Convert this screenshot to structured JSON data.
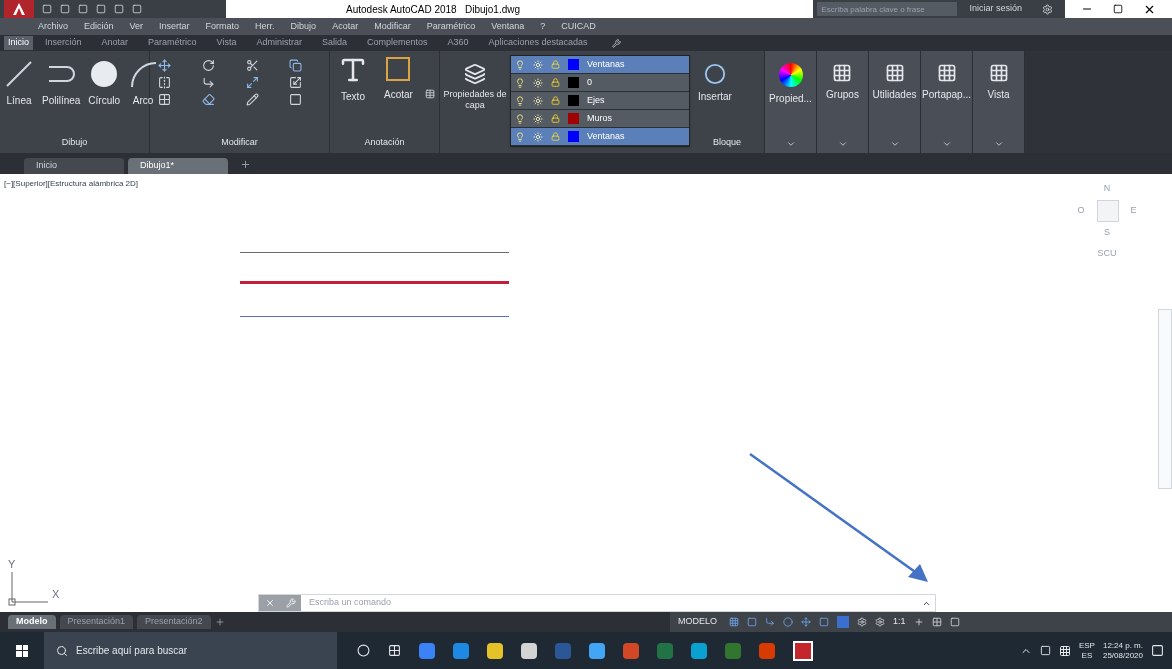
{
  "title_bar": {
    "title": "Autodesk AutoCAD 2018   Dibujo1.dwg",
    "search": {
      "placeholder": "Escriba palabra clave o frase"
    },
    "sign_in": "Iniciar sesión"
  },
  "menu_bar": [
    "Archivo",
    "Edición",
    "Ver",
    "Insertar",
    "Formato",
    "Herr.",
    "Dibujo",
    "Acotar",
    "Modificar",
    "Paramétrico",
    "Ventana",
    "?",
    "CUICAD"
  ],
  "ribbon_tabs": [
    {
      "label": "Inicio",
      "selected": true
    },
    {
      "label": "Inserción",
      "selected": false
    },
    {
      "label": "Anotar",
      "selected": false
    },
    {
      "label": "Paramétrico",
      "selected": false
    },
    {
      "label": "Vista",
      "selected": false
    },
    {
      "label": "Administrar",
      "selected": false
    },
    {
      "label": "Salida",
      "selected": false
    },
    {
      "label": "Complementos",
      "selected": false
    },
    {
      "label": "A360",
      "selected": false
    },
    {
      "label": "Aplicaciones destacadas",
      "selected": false
    }
  ],
  "draw_panel": {
    "title": "Dibujo",
    "tools": [
      "Línea",
      "Polilínea",
      "Círculo",
      "Arco"
    ]
  },
  "modify_panel": {
    "title": "Modificar"
  },
  "annotation_panel": {
    "title": "Anotación",
    "tools": [
      "Texto",
      "Acotar"
    ]
  },
  "layer_properties": "Propiedades de capa",
  "layer_dropdown": {
    "current": {
      "name": "Ventanas",
      "color": "#0000ff"
    },
    "layers": [
      {
        "name": "0",
        "color": "#000000",
        "selected": false
      },
      {
        "name": "Ejes",
        "color": "#000000",
        "selected": false
      },
      {
        "name": "Muros",
        "color": "#a00000",
        "selected": false
      },
      {
        "name": "Ventanas",
        "color": "#0000ff",
        "selected": true
      }
    ]
  },
  "block_panel": {
    "title": "Bloque",
    "tool": "Insertar"
  },
  "extra_panels": [
    "Propied...",
    "Grupos",
    "Utilidades",
    "Portapap...",
    "Vista"
  ],
  "document_tabs": [
    {
      "label": "Inicio",
      "selected": false
    },
    {
      "label": "Dibujo1*",
      "selected": true
    }
  ],
  "viewport_label": "[−][Superior][Estructura alámbrica 2D]",
  "drawing_lines": [
    {
      "color": "#6b6b6b"
    },
    {
      "color": "#c0203a"
    },
    {
      "color": "#5a6cc8"
    }
  ],
  "view_cube": {
    "north": "N",
    "west": "O",
    "east": "E",
    "south": "S",
    "ucs": "SCU"
  },
  "ucs_icon": {
    "y": "Y",
    "x": "X"
  },
  "command_line": {
    "placeholder": "Escriba un comando"
  },
  "layout_tabs": [
    {
      "label": "Modelo",
      "selected": true
    },
    {
      "label": "Presentación1",
      "selected": false
    },
    {
      "label": "Presentación2",
      "selected": false
    }
  ],
  "status_bar": {
    "space": "MODELO",
    "annotation_scale": "1:1"
  },
  "taskbar": {
    "search_placeholder": "Escribe aquí para buscar",
    "language": "ESP",
    "region": "ES",
    "time": "12:24 p. m.",
    "date": "25/08/2020"
  }
}
